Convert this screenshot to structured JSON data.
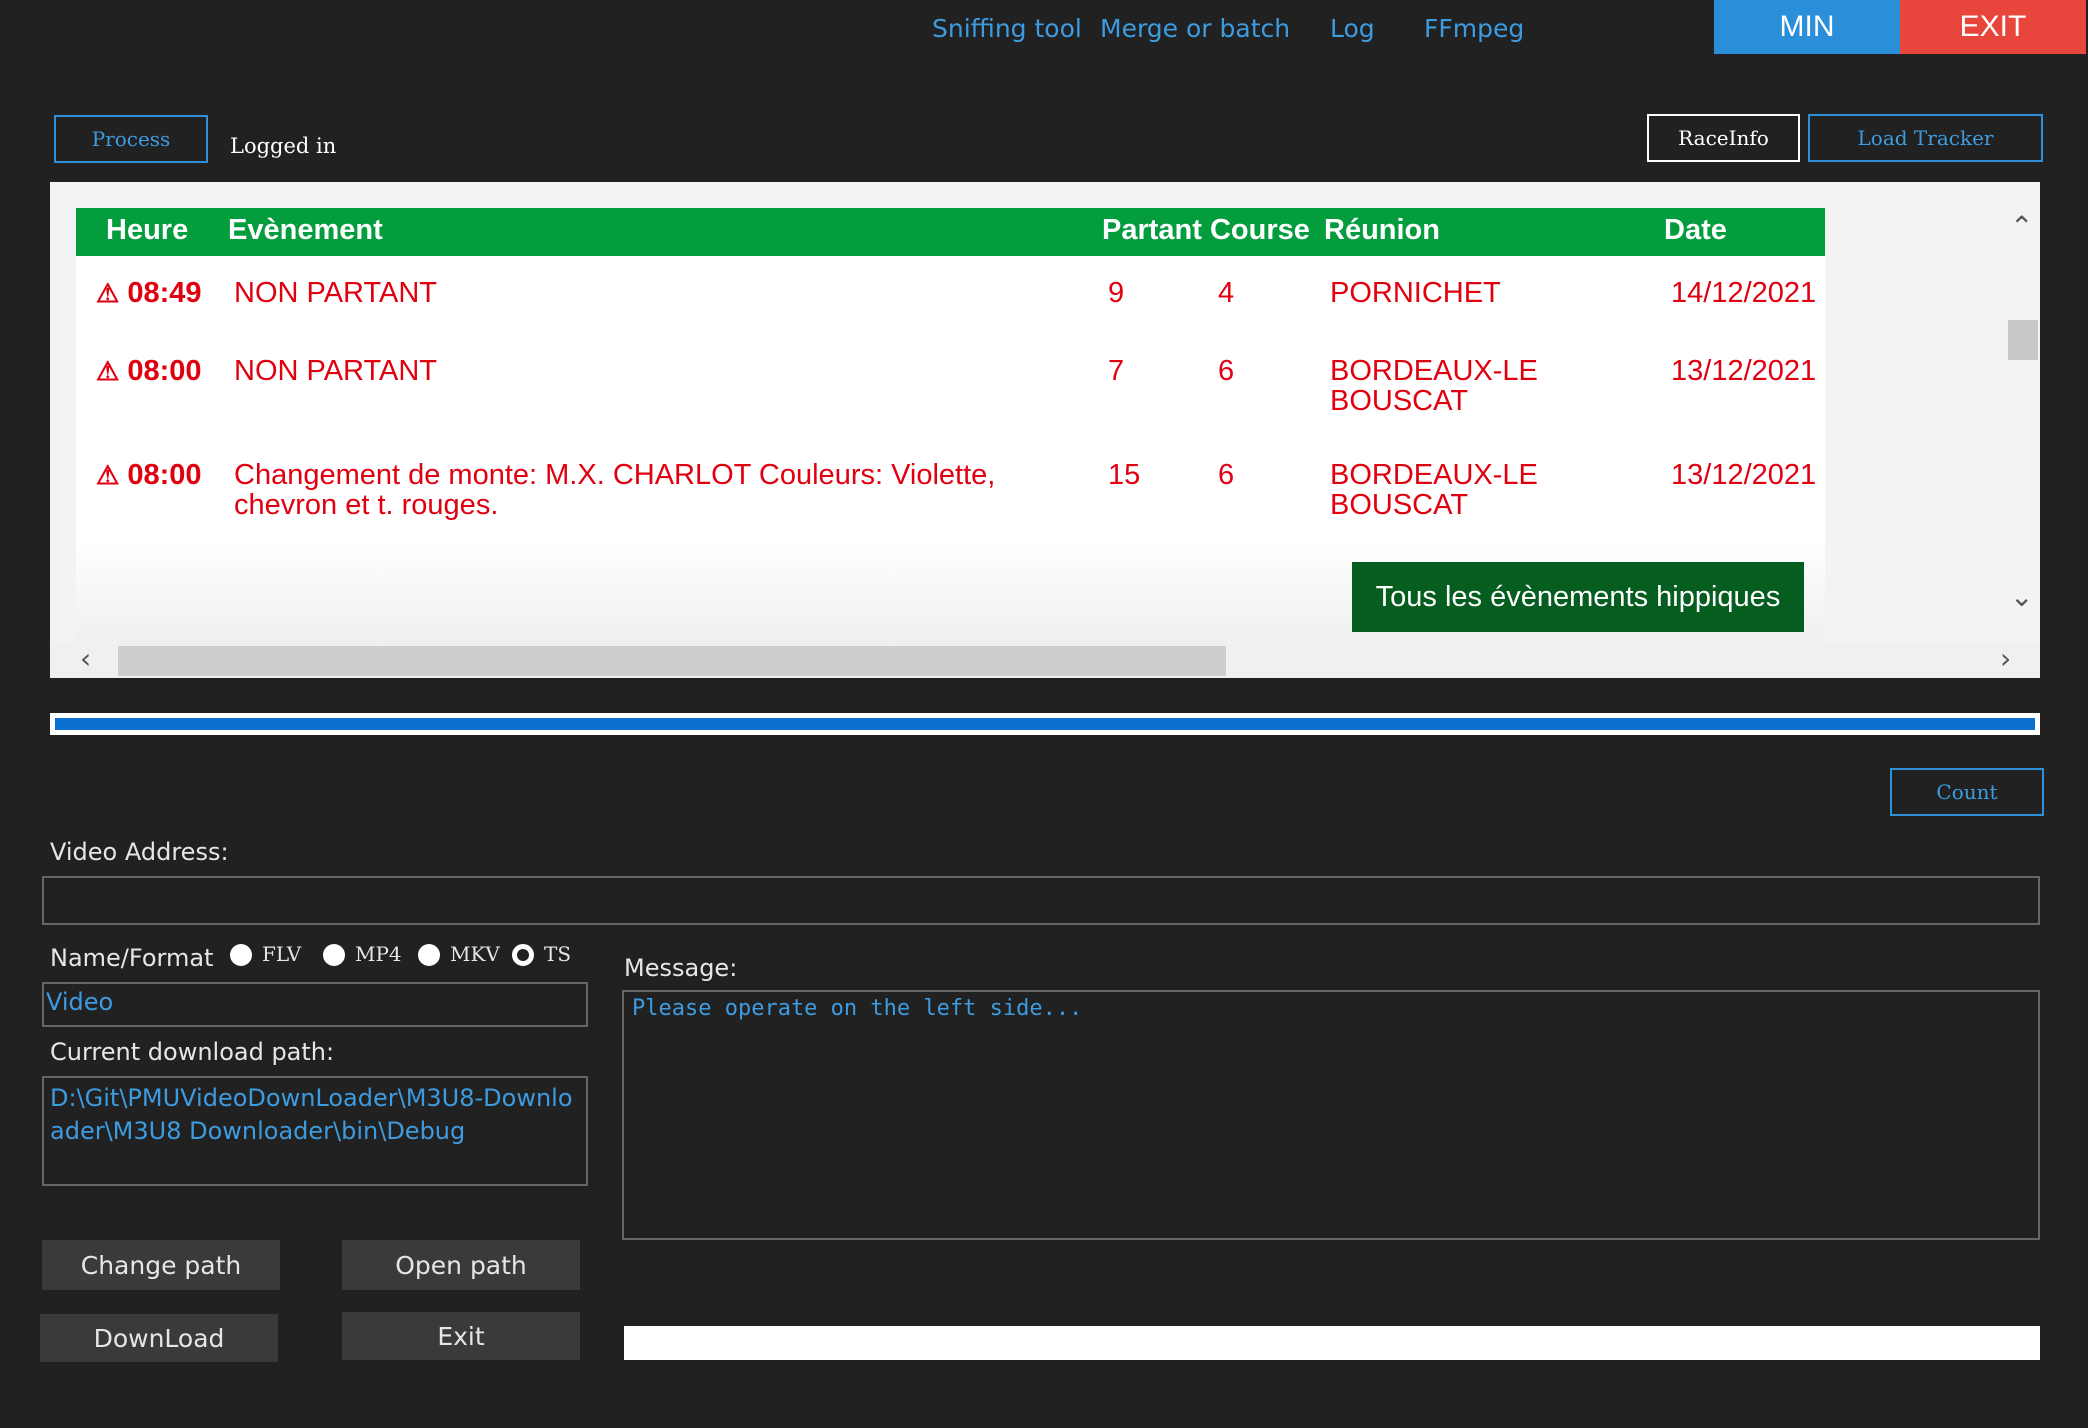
{
  "menu": {
    "items": [
      "Sniffing tool",
      "Merge or batch",
      "Log",
      "FFmpeg"
    ],
    "min_label": "MIN",
    "exit_label": "EXIT"
  },
  "toolbar": {
    "process_label": "Process",
    "status": "Logged in",
    "raceinfo_label": "RaceInfo",
    "load_tracker_label": "Load Tracker"
  },
  "events": {
    "headers": {
      "heure": "Heure",
      "evenement": "Evènement",
      "partant_course": "Partant Course",
      "reunion": "Réunion",
      "date": "Date"
    },
    "rows": [
      {
        "icon": "⚠",
        "time": "08:49",
        "event": "NON PARTANT",
        "partant": "9",
        "course": "4",
        "reunion": "PORNICHET",
        "date": "14/12/2021"
      },
      {
        "icon": "⚠",
        "time": "08:00",
        "event": "NON PARTANT",
        "partant": "7",
        "course": "6",
        "reunion": "BORDEAUX-LE BOUSCAT",
        "date": "13/12/2021"
      },
      {
        "icon": "⚠",
        "time": "08:00",
        "event": "Changement de monte: M.X. CHARLOT Couleurs: Violette, chevron et t. rouges.",
        "partant": "15",
        "course": "6",
        "reunion": "BORDEAUX-LE BOUSCAT",
        "date": "13/12/2021"
      }
    ],
    "all_events_label": "Tous les évènements hippiques"
  },
  "download_progress": 1.0,
  "count_label": "Count",
  "video_address": {
    "label": "Video Address:",
    "value": ""
  },
  "name_format": {
    "label": "Name/Format",
    "options": [
      "FLV",
      "MP4",
      "MKV",
      "TS"
    ],
    "selected": "TS",
    "name_value": "Video"
  },
  "download_path": {
    "label": "Current download path:",
    "value": "D:\\Git\\PMUVideoDownLoader\\M3U8-Downloader\\M3U8 Downloader\\bin\\Debug"
  },
  "message": {
    "label": "Message:",
    "text": "Please operate on the left side..."
  },
  "buttons": {
    "change_path": "Change path",
    "open_path": "Open path",
    "download": "DownLoad",
    "exit": "Exit"
  },
  "colors": {
    "background": "#212121",
    "accent_blue": "#3d9be0",
    "min_button": "#2a8fd8",
    "exit_button": "#e8463c",
    "header_green": "#039d3e",
    "event_red": "#e0000f",
    "dark_green_button": "#065d20"
  }
}
